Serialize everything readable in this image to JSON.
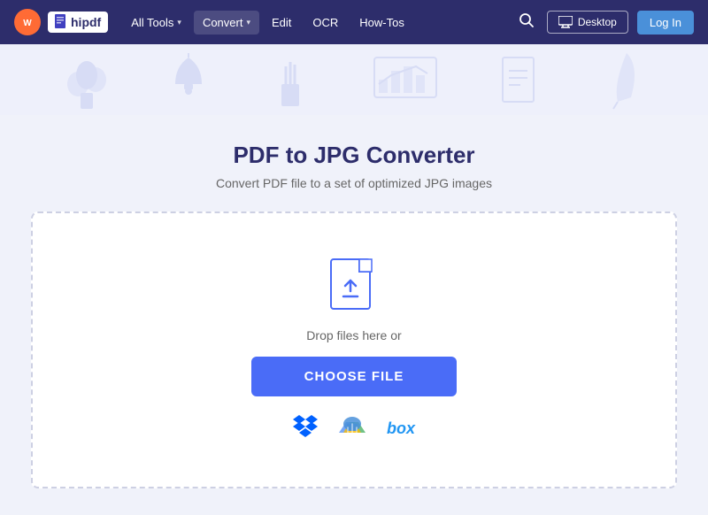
{
  "brand": {
    "wondershare_label": "W",
    "hipdf_label": "hipdf"
  },
  "navbar": {
    "all_tools_label": "All Tools",
    "convert_label": "Convert",
    "edit_label": "Edit",
    "ocr_label": "OCR",
    "howtos_label": "How-Tos",
    "desktop_label": "Desktop",
    "login_label": "Log In"
  },
  "page": {
    "title": "PDF to JPG Converter",
    "subtitle": "Convert PDF file to a set of optimized JPG images"
  },
  "dropzone": {
    "drop_text": "Drop files here or",
    "choose_btn_label": "CHOOSE FILE"
  },
  "cloud_services": {
    "dropbox_label": "Dropbox",
    "gdrive_label": "Google Drive",
    "box_label": "box"
  }
}
